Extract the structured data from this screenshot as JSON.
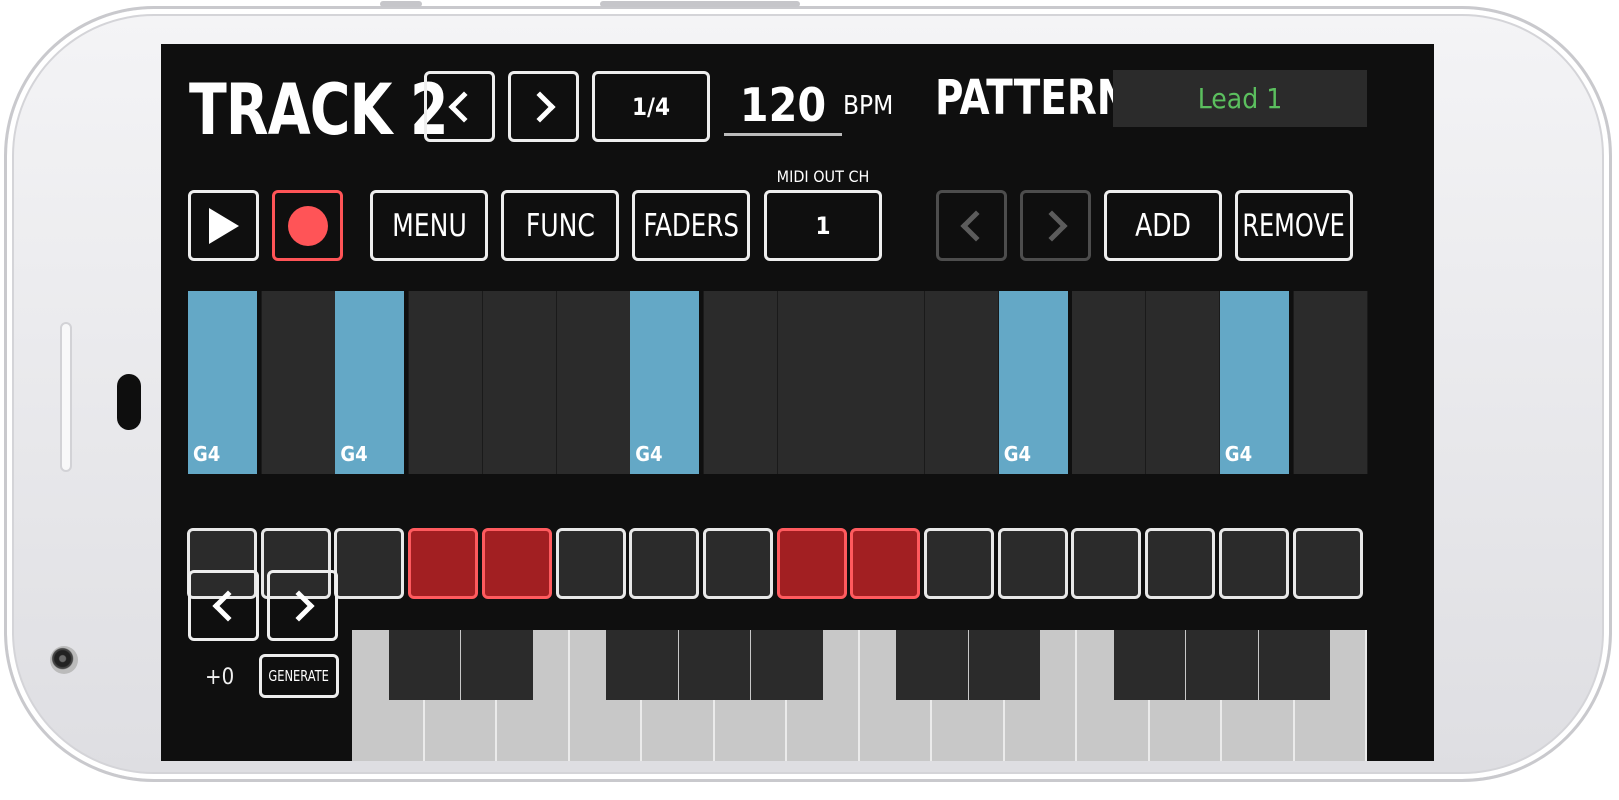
{
  "header": {
    "track_title": "TRACK 2",
    "division": "1/4",
    "tempo": "120",
    "tempo_unit": "BPM",
    "pattern_label": "PATTERN",
    "pattern_name": "Lead 1",
    "pattern_name_color": "#5bbf5e"
  },
  "toolbar": {
    "menu": "MENU",
    "func": "FUNC",
    "faders": "FADERS",
    "midi_out_label": "MIDI OUT CH",
    "midi_out_value": "1",
    "add": "ADD",
    "remove": "REMOVE",
    "record_color": "#ff5457"
  },
  "grid": {
    "note_color": "#64a8c6",
    "active_step_color": "#a21f22",
    "notes": [
      {
        "step": 1,
        "label": "G4"
      },
      {
        "step": 3,
        "label": "G4"
      },
      {
        "step": 7,
        "label": "G4"
      },
      {
        "step": 12,
        "label": "G4"
      },
      {
        "step": 15,
        "label": "G4"
      }
    ],
    "active_steps": [
      4,
      5,
      9,
      10
    ]
  },
  "keyboard": {
    "octave_offset": "+0",
    "generate": "GENERATE"
  }
}
